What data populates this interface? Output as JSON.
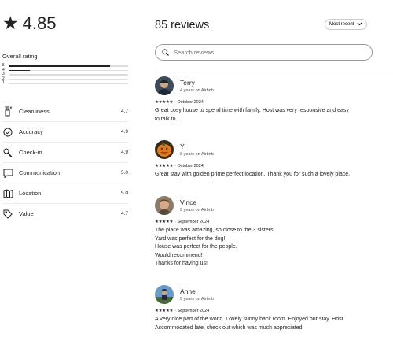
{
  "rating": {
    "star": "★",
    "value": "4.85"
  },
  "overall": {
    "label": "Overall rating",
    "bars": [
      {
        "label": "5",
        "fraction": 0.85
      },
      {
        "label": "4",
        "fraction": 0.18
      },
      {
        "label": "3",
        "fraction": 0
      },
      {
        "label": "2",
        "fraction": 0
      },
      {
        "label": "1",
        "fraction": 0
      }
    ]
  },
  "categories": [
    {
      "name": "Cleanliness",
      "score": "4.7",
      "icon": "spray-bottle-icon"
    },
    {
      "name": "Accuracy",
      "score": "4.9",
      "icon": "check-circle-icon"
    },
    {
      "name": "Check-in",
      "score": "4.9",
      "icon": "key-icon"
    },
    {
      "name": "Communication",
      "score": "5.0",
      "icon": "chat-bubble-icon"
    },
    {
      "name": "Location",
      "score": "5.0",
      "icon": "map-icon"
    },
    {
      "name": "Value",
      "score": "4.7",
      "icon": "tag-icon"
    }
  ],
  "reviews_header": {
    "title": "85 reviews",
    "sort_label": "Most recent"
  },
  "search": {
    "placeholder": "Search reviews"
  },
  "reviews": [
    {
      "name": "Terry",
      "tenure": "4 years on Airbnb",
      "stars": "★★★★★",
      "date": "· October 2024",
      "lines": [
        "Great cosy house to spend time with family. Host was very responsive and easy",
        "to talk to."
      ],
      "avatar_color": "#4a5a6a"
    },
    {
      "name": "Y",
      "tenure": "8 years on Airbnb",
      "stars": "★★★★★",
      "date": "· October 2024",
      "lines": [
        "Great stay with golden prime perfect location. Thank you for such a lovely place."
      ],
      "avatar_color": "#e07a1f"
    },
    {
      "name": "Vince",
      "tenure": "9 years on Airbnb",
      "stars": "★★★★★",
      "date": "· September 2024",
      "lines": [
        "The place was amazing, so close to the 3 sisters!",
        "Yard was perfect for the dog!",
        "House was perfect for the people.",
        "Would recommend!",
        "Thanks for having us!"
      ],
      "avatar_color": "#b58a6e"
    },
    {
      "name": "Anne",
      "tenure": "9 years on Airbnb",
      "stars": "★★★★★",
      "date": "· September 2024",
      "lines": [
        "A very nice part of the world. Lovely sunny back room. Enjoyed our stay. Host",
        "Accommodated late, check out which was much appreciated"
      ],
      "avatar_color": "#5a8ab5"
    }
  ]
}
